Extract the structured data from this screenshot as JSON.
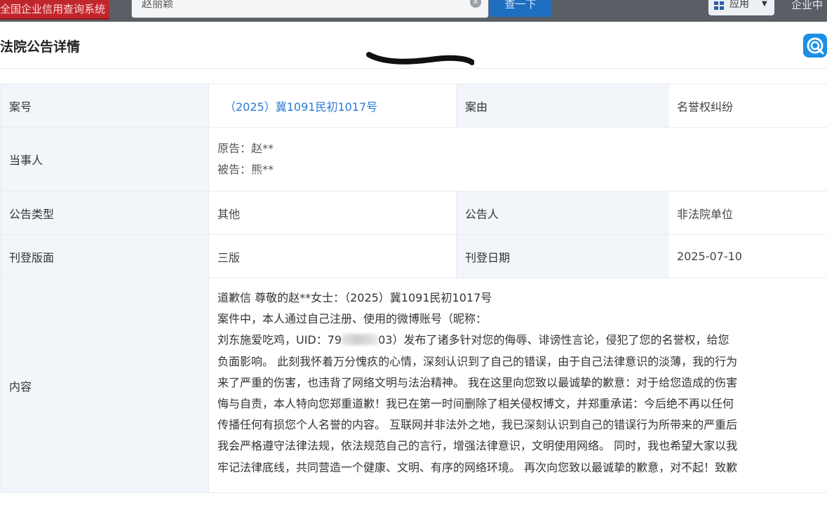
{
  "topbar": {
    "site_name": "全国企业信用查询系统",
    "search_value": "赵丽颖",
    "search_button": "查一下",
    "apps_label": "应用",
    "right_text": "企业中"
  },
  "panel": {
    "title": "法院公告详情"
  },
  "rows": {
    "case_no_label": "案号",
    "case_no_value": "（2025）冀1091民初1017号",
    "cause_label": "案由",
    "cause_value": "名誉权纠纷",
    "parties_label": "当事人",
    "plaintiff": "原告：赵**",
    "defendant": "被告：熊**",
    "type_label": "公告类型",
    "type_value": "其他",
    "announcer_label": "公告人",
    "announcer_value": "非法院单位",
    "page_label": "刊登版面",
    "page_value": "三版",
    "date_label": "刊登日期",
    "date_value": "2025-07-10",
    "content_label": "内容"
  },
  "content": {
    "line1": "道歉信 尊敬的赵**女士：（2025）冀1091民初1017号",
    "line2": "案件中，本人通过自己注册、使用的微博账号（昵称：",
    "line3_start": "刘东施爱吃鸡，UID：79",
    "line3_end": "03）发布了诸多针对您的侮辱、诽谤性言论，侵犯了您的名誉权，给您",
    "line4": "负面影响。 此刻我怀着万分愧疚的心情，深刻认识到了自己的错误，由于自己法律意识的淡薄，我的行为",
    "line5": "来了严重的伤害，也违背了网络文明与法治精神。 我在这里向您致以最诚挚的歉意：对于给您造成的伤害",
    "line6": "悔与自责，本人特向您郑重道歉！我已在第一时间删除了相关侵权博文，并郑重承诺：今后绝不再以任何",
    "line7": "传播任何有损您个人名誉的内容。 互联网并非法外之地，我已深刻认识到自己的错误行为所带来的严重后",
    "line8": "我会严格遵守法律法规，依法规范自己的言行，增强法律意识，文明使用网络。 同时，我也希望大家以我",
    "line9": "牢记法律底线，共同营造一个健康、文明、有序的网络环境。 再次向您致以最诚挚的歉意，对不起！致歉"
  },
  "colors": {
    "link": "#2b7bd3",
    "label_bg": "#f2f6fb",
    "site_badge": "#c0272d",
    "search_button": "#1e6fc0"
  },
  "icons": {
    "search_clear": "close-circle-icon",
    "apps": "grid-icon",
    "apps_caret": "caret-down-icon",
    "corner_logo": "app-logo-icon"
  }
}
